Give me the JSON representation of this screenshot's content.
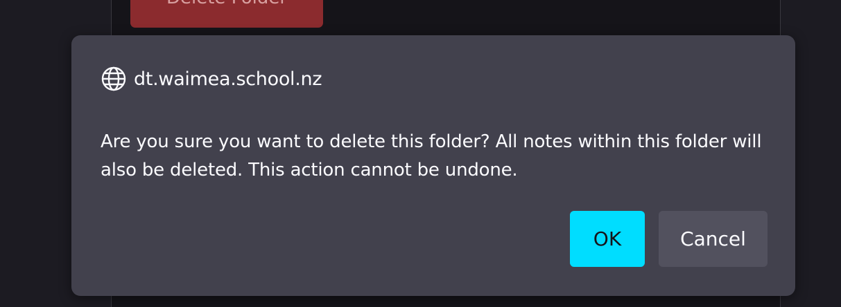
{
  "background": {
    "delete_folder_label": "Delete Folder",
    "delete_folder_color": "#8b2b2e"
  },
  "dialog": {
    "origin": "dt.waimea.school.nz",
    "origin_icon": "globe-icon",
    "message": "Are you sure you want to delete this folder? All notes within this folder will also be deleted. This action cannot be undone.",
    "ok_label": "OK",
    "cancel_label": "Cancel",
    "ok_color": "#00ddff",
    "cancel_color": "#52515e",
    "dialog_color": "#42414d"
  }
}
